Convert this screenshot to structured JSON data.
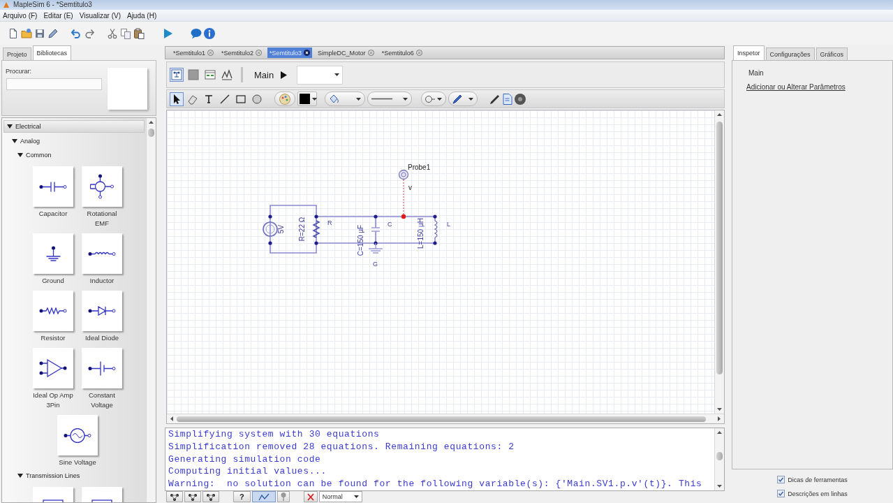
{
  "window": {
    "title": "MapleSim 6 - *Semtitulo3"
  },
  "menu": [
    {
      "label": "Arquivo (F)"
    },
    {
      "label": "Editar (E)"
    },
    {
      "label": "Visualizar (V)"
    },
    {
      "label": "Ajuda (H)"
    }
  ],
  "left_panel": {
    "tabs": [
      {
        "label": "Projeto",
        "selected": false
      },
      {
        "label": "Bibliotecas",
        "selected": true
      }
    ],
    "search": {
      "label": "Procurar:"
    },
    "tree": [
      {
        "label": "Electrical",
        "expanded": true,
        "children": [
          {
            "label": "Analog",
            "expanded": true,
            "children": [
              {
                "label": "Common",
                "expanded": true,
                "components": [
                  {
                    "kind": "capacitor",
                    "label": "Capacitor"
                  },
                  {
                    "kind": "rotational_emf",
                    "label": "Rotational EMF"
                  },
                  {
                    "kind": "ground",
                    "label": "Ground"
                  },
                  {
                    "kind": "inductor",
                    "label": "Inductor"
                  },
                  {
                    "kind": "resistor",
                    "label": "Resistor"
                  },
                  {
                    "kind": "ideal_diode",
                    "label": "Ideal Diode"
                  },
                  {
                    "kind": "op_amp",
                    "label": "Ideal Op Amp 3Pin"
                  },
                  {
                    "kind": "constant_voltage",
                    "label": "Constant Voltage"
                  },
                  {
                    "kind": "sine_voltage",
                    "label": "Sine Voltage"
                  }
                ]
              },
              {
                "label": "Transmission Lines",
                "expanded": true,
                "components": [
                  {
                    "kind": "transmission_line"
                  },
                  {
                    "kind": "transmission_line"
                  }
                ]
              }
            ]
          }
        ]
      }
    ]
  },
  "document_tabs": [
    {
      "label": "*Semtitulo1",
      "selected": false
    },
    {
      "label": "*Semtitulo2",
      "selected": false
    },
    {
      "label": "*Semtitulo3",
      "selected": true
    },
    {
      "label": "SimpleDC_Motor",
      "selected": false
    },
    {
      "label": "*Semtitulo6",
      "selected": false
    }
  ],
  "editor": {
    "view_modes": [
      {
        "kind": "diagram",
        "selected": true
      },
      {
        "kind": "block",
        "selected": false
      },
      {
        "kind": "layout",
        "selected": false
      },
      {
        "kind": "plot",
        "selected": false
      }
    ],
    "breadcrumb": "Main",
    "drawing_tools": [
      {
        "kind": "pointer",
        "selected": true
      },
      {
        "kind": "eraser",
        "selected": false
      },
      {
        "kind": "text",
        "selected": false
      },
      {
        "kind": "line",
        "selected": false
      },
      {
        "kind": "rectangle",
        "selected": false
      },
      {
        "kind": "ellipse",
        "selected": false
      }
    ]
  },
  "diagram": {
    "components": [
      {
        "kind": "voltage_source",
        "value": "5V"
      },
      {
        "kind": "resistor",
        "name": "R",
        "value": "R=22 Ω"
      },
      {
        "kind": "capacitor",
        "name": "C",
        "value": "C=150 µF"
      },
      {
        "kind": "ground",
        "name": "G"
      },
      {
        "kind": "inductor",
        "name": "L",
        "value": "L=150 µH"
      },
      {
        "kind": "probe",
        "name": "Probe1",
        "value": "v"
      }
    ]
  },
  "console": {
    "lines": [
      "Simplifying system with 30 equations",
      "Simplification removed 28 equations. Remaining equations: 2",
      "Generating simulation code",
      "Computing initial values...",
      "Warning:  no solution can be found for the following variable(s): {'Main.SV1.p.v'(t)}. This"
    ]
  },
  "console_toolbar": {
    "help": "?",
    "mode": "Normal"
  },
  "right_panel": {
    "tabs": [
      {
        "label": "Inspetor",
        "selected": true
      },
      {
        "label": "Configurações",
        "selected": false
      },
      {
        "label": "Gráficos",
        "selected": false
      }
    ],
    "title": "Main",
    "link": "Adicionar ou Alterar Parâmetros",
    "options": [
      {
        "label": "Dicas de ferramentas",
        "checked": true
      },
      {
        "label": "Descrições em linhas",
        "checked": true
      }
    ]
  }
}
